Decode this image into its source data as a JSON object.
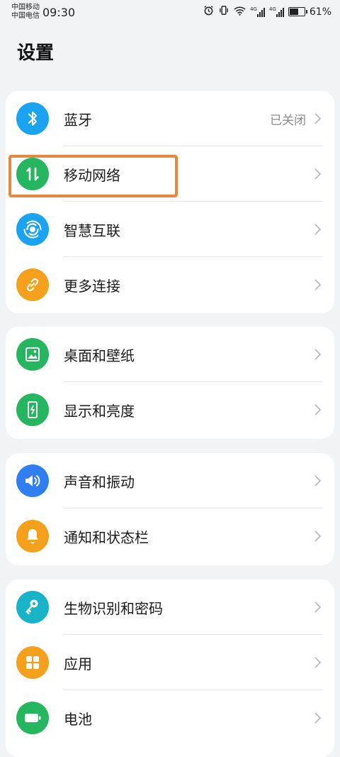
{
  "status_bar": {
    "carrier1": "中国移动",
    "carrier2": "中国电信",
    "time": "09:30",
    "net1": "4G",
    "net2": "4G",
    "battery": "61%",
    "battery_level": 0.61
  },
  "title": "设置",
  "groups": [
    {
      "items": [
        {
          "label": "蓝牙",
          "value": "已关闭",
          "icon": "bluetooth-icon",
          "color": "#1aa3f0"
        },
        {
          "label": "移动网络",
          "value": "",
          "icon": "mobile-data-icon",
          "color": "#27b660"
        },
        {
          "label": "智慧互联",
          "value": "",
          "icon": "smart-connect-icon",
          "color": "#1aa3f0"
        },
        {
          "label": "更多连接",
          "value": "",
          "icon": "link-icon",
          "color": "#f5a01d"
        }
      ]
    },
    {
      "items": [
        {
          "label": "桌面和壁纸",
          "value": "",
          "icon": "wallpaper-icon",
          "color": "#27b660"
        },
        {
          "label": "显示和亮度",
          "value": "",
          "icon": "display-icon",
          "color": "#27b660"
        }
      ]
    },
    {
      "items": [
        {
          "label": "声音和振动",
          "value": "",
          "icon": "speaker-icon",
          "color": "#2f7ff0"
        },
        {
          "label": "通知和状态栏",
          "value": "",
          "icon": "bell-icon",
          "color": "#f5a01d"
        }
      ]
    },
    {
      "items": [
        {
          "label": "生物识别和密码",
          "value": "",
          "icon": "key-icon",
          "color": "#18b3c6"
        },
        {
          "label": "应用",
          "value": "",
          "icon": "apps-icon",
          "color": "#f5a01d"
        },
        {
          "label": "电池",
          "value": "",
          "icon": "battery-icon",
          "color": "#27b660"
        }
      ]
    }
  ]
}
